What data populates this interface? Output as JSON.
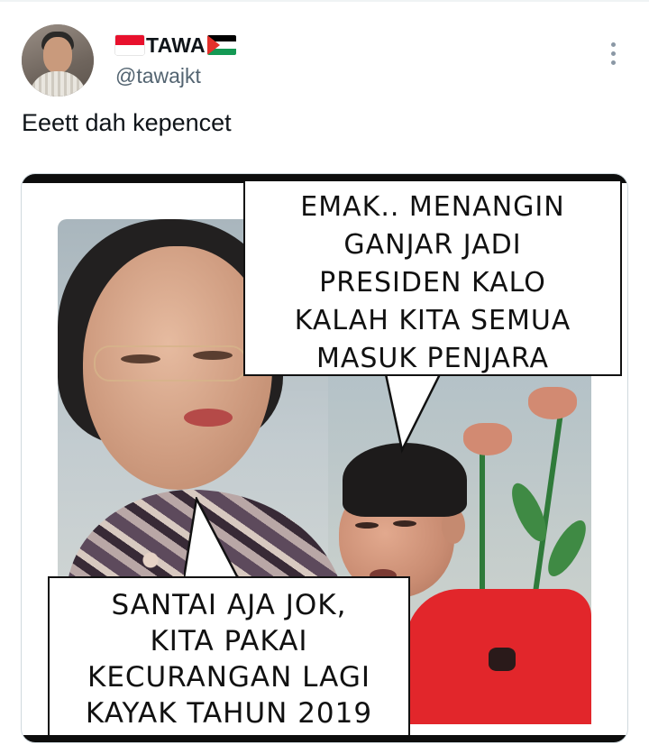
{
  "tweet": {
    "display_name": "TAWA",
    "flags": [
      "indonesia-flag",
      "palestine-flag"
    ],
    "handle": "@tawajkt",
    "text": "Eeett dah kepencet",
    "more_icon": "ellipsis-vertical-icon"
  },
  "meme": {
    "top_bubble_lines": [
      "EMAK.. MENANGIN",
      "GANJAR JADI",
      "PRESIDEN KALO",
      "KALAH KITA SEMUA",
      "MASUK PENJARA"
    ],
    "bottom_bubble_lines": [
      "SANTAI AJA JOK,",
      "KITA PAKAI",
      "KECURANGAN LAGI",
      "KAYAK TAHUN 2019"
    ]
  },
  "colors": {
    "text_primary": "#0f1419",
    "text_secondary": "#536471",
    "icon_gray": "#8b98a5",
    "divider": "#eff3f4"
  }
}
